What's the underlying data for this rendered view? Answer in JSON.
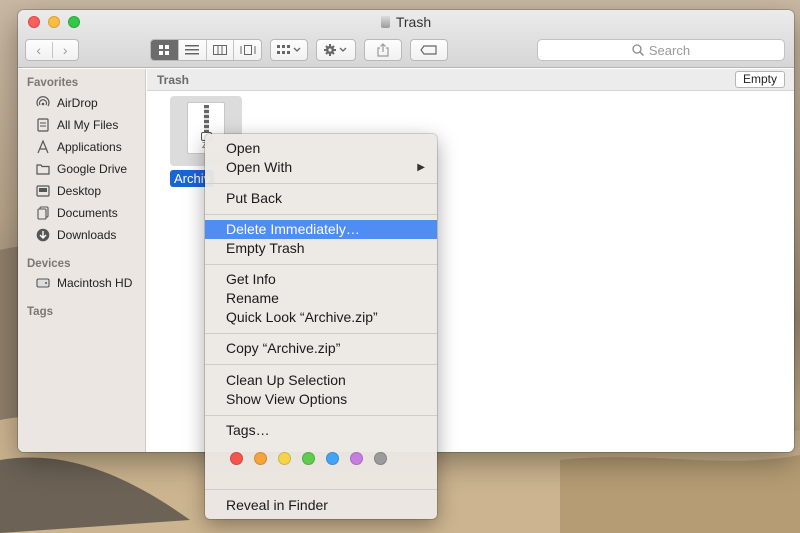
{
  "window": {
    "title": "Trash",
    "nav_back": "‹",
    "nav_forward": "›",
    "search_placeholder": "Search"
  },
  "sidebar": {
    "favorites_header": "Favorites",
    "favorites": [
      {
        "label": "AirDrop",
        "icon": "airdrop-icon"
      },
      {
        "label": "All My Files",
        "icon": "all-files-icon"
      },
      {
        "label": "Applications",
        "icon": "applications-icon"
      },
      {
        "label": "Google Drive",
        "icon": "folder-icon"
      },
      {
        "label": "Desktop",
        "icon": "desktop-icon"
      },
      {
        "label": "Documents",
        "icon": "documents-icon"
      },
      {
        "label": "Downloads",
        "icon": "downloads-icon"
      }
    ],
    "devices_header": "Devices",
    "devices": [
      {
        "label": "Macintosh HD",
        "icon": "harddisk-icon"
      }
    ],
    "tags_header": "Tags"
  },
  "content": {
    "path_label": "Trash",
    "empty_button": "Empty",
    "file_label": "Archiv",
    "file_icon_text": "ZI"
  },
  "context_menu": {
    "items": {
      "open": "Open",
      "open_with": "Open With",
      "open_with_arrow": "▶",
      "put_back": "Put Back",
      "delete_immediately": "Delete Immediately…",
      "empty_trash": "Empty Trash",
      "get_info": "Get Info",
      "rename": "Rename",
      "quick_look": "Quick Look “Archive.zip”",
      "copy": "Copy “Archive.zip”",
      "clean_up": "Clean Up Selection",
      "show_view_options": "Show View Options",
      "tags": "Tags…",
      "reveal": "Reveal in Finder"
    },
    "highlighted_item": "Delete Immediately…",
    "tag_colors": [
      {
        "name": "red",
        "color": "#f3554f"
      },
      {
        "name": "orange",
        "color": "#f5a33c"
      },
      {
        "name": "yellow",
        "color": "#f4d44a"
      },
      {
        "name": "green",
        "color": "#5fcb4f"
      },
      {
        "name": "blue",
        "color": "#43a4f7"
      },
      {
        "name": "purple",
        "color": "#c57ee0"
      },
      {
        "name": "gray",
        "color": "#9b9b9b"
      }
    ]
  },
  "colors": {
    "selection": "#1b64d8",
    "menu_highlight": "#4f8cf4"
  }
}
